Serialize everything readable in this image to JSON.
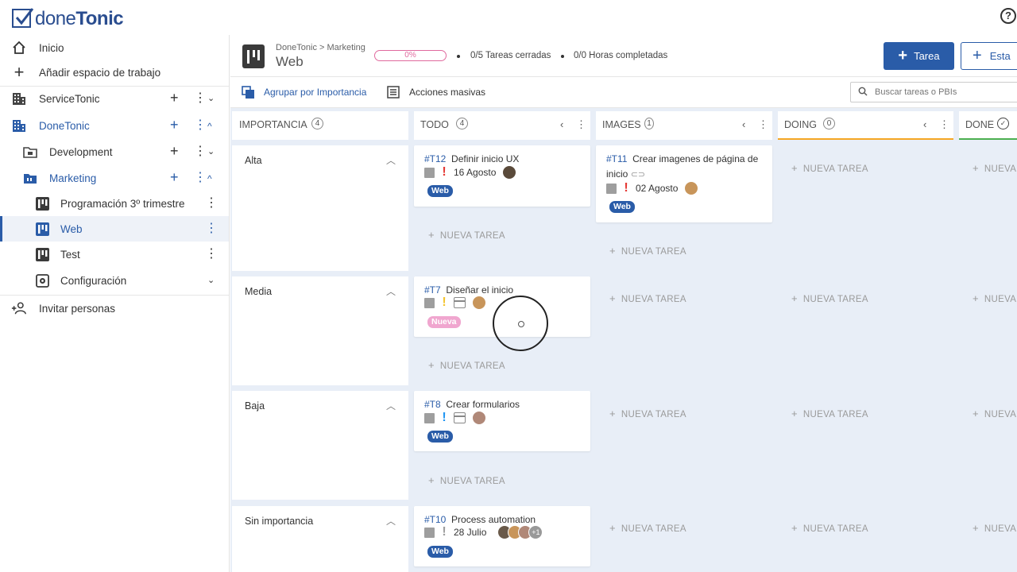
{
  "app": {
    "logo_done": "done",
    "logo_tonic": "Tonic",
    "help_symbol": "?"
  },
  "sidebar": {
    "items": [
      {
        "label": "Inicio",
        "icon": "home-icon"
      },
      {
        "label": "Añadir espacio de trabajo",
        "icon": "plus-icon"
      },
      {
        "label": "ServiceTonic",
        "icon": "building-icon"
      },
      {
        "label": "DoneTonic",
        "icon": "building-icon"
      },
      {
        "label": "Development",
        "icon": "folder-icon"
      },
      {
        "label": "Marketing",
        "icon": "folder-icon"
      },
      {
        "label": "Programación 3º trimestre",
        "icon": "board-icon"
      },
      {
        "label": "Web",
        "icon": "board-icon"
      },
      {
        "label": "Test",
        "icon": "board-icon"
      },
      {
        "label": "Configuración",
        "icon": "settings-icon"
      },
      {
        "label": "Invitar personas",
        "icon": "add-person-icon"
      }
    ]
  },
  "header": {
    "breadcrumb": "DoneTonic > Marketing",
    "title": "Web",
    "progress_label": "0%",
    "progress": 0,
    "tasks_closed": "0/5 Tareas cerradas",
    "hours_completed": "0/0 Horas completadas",
    "new_task_label": "Tarea",
    "new_state_label": "Esta"
  },
  "toolbar": {
    "group_by_label": "Agrupar por Importancia",
    "bulk_actions_label": "Acciones masivas",
    "search_placeholder": "Buscar tareas o PBIs"
  },
  "board": {
    "group_header": {
      "label": "IMPORTANCIA",
      "count": "4"
    },
    "columns": [
      {
        "name": "TODO",
        "count": "4",
        "color": "#ffffff"
      },
      {
        "name": "IMAGES",
        "count": "1",
        "color": "#ffffff"
      },
      {
        "name": "DOING",
        "count": "0",
        "color": "#f5a623"
      },
      {
        "name": "DONE",
        "count": "",
        "color": "#4caf50"
      }
    ],
    "groups": [
      {
        "name": "Alta"
      },
      {
        "name": "Media"
      },
      {
        "name": "Baja"
      },
      {
        "name": "Sin importancia"
      }
    ],
    "new_task_label": "NUEVA TAREA",
    "new_task_cut_label": "NUEVA TAREA",
    "new_task_short": "NUEVA",
    "cards": [
      {
        "id": "#T12",
        "title": "Definir inicio UX",
        "date": "16 Agosto",
        "tag": "Web",
        "tag_color": "#2a5ca8",
        "priority_color": "#e53935"
      },
      {
        "id": "#T11",
        "title": "Crear imagenes de página de inicio",
        "date": "02 Agosto",
        "tag": "Web",
        "tag_color": "#2a5ca8",
        "priority_color": "#e53935"
      },
      {
        "id": "#T7",
        "title": "Diseñar el inicio",
        "date": "",
        "tag": "Nueva",
        "tag_color": "#f0a6cf",
        "priority_color": "#f4c430"
      },
      {
        "id": "#T8",
        "title": "Crear formularios",
        "date": "",
        "tag": "Web",
        "tag_color": "#2a5ca8",
        "priority_color": "#2196f3"
      },
      {
        "id": "#T10",
        "title": "Process automation",
        "date": "28 Julio",
        "tag": "Web",
        "tag_color": "#2a5ca8",
        "priority_color": "#9e9e9e",
        "extra_avatars": "+1"
      }
    ]
  }
}
